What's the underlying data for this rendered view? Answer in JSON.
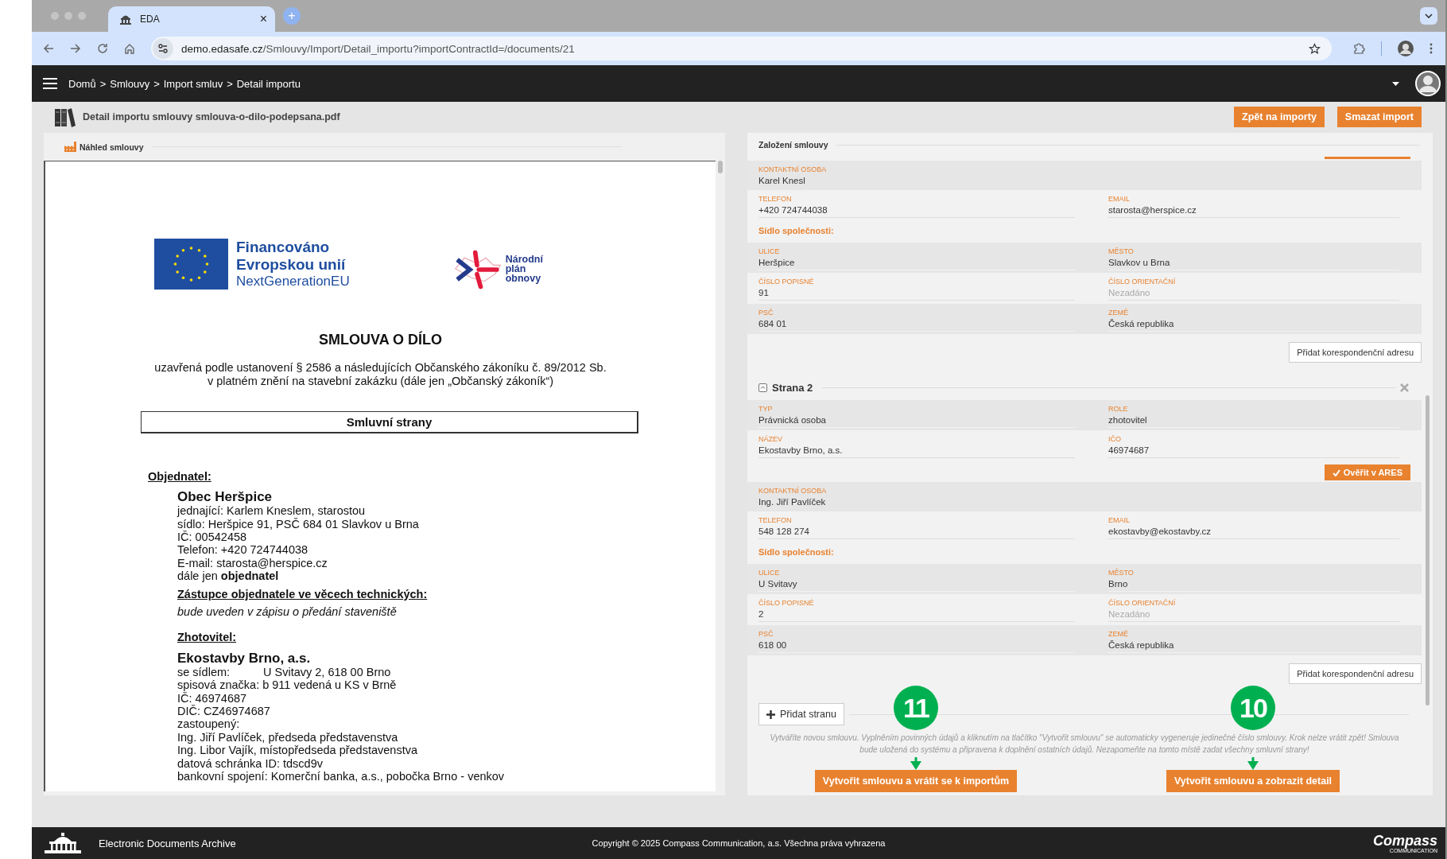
{
  "browser": {
    "tab": {
      "title": "EDA",
      "close": "×",
      "selected": true
    },
    "new_tab": "+",
    "url": {
      "host": "demo.edasafe.cz",
      "path": "/Smlouvy/Import/Detail_importu?importContractId=/documents/21"
    }
  },
  "app_bar": {
    "breadcrumb": [
      "Domů",
      "Smlouvy",
      "Import smluv",
      "Detail importu"
    ],
    "separator": ">"
  },
  "page_title": "Detail importu smlouvy smlouva-o-dilo-podepsana.pdf",
  "header_buttons": [
    "Zpět na importy",
    "Smazat import"
  ],
  "preview": {
    "title": "Náhled smlouvy",
    "document": {
      "eu_logo": [
        "Financováno",
        "Evropskou unií",
        "NextGenerationEU"
      ],
      "npo_logo": [
        "Národní",
        "plán",
        "obnovy"
      ],
      "title": "SMLOUVA O DÍLO",
      "subtitle": [
        "uzavřená podle ustanovení § 2586 a následujících Občanského zákoníku č. 89/2012 Sb.",
        "v platném znění na stavební zakázku (dále jen „Občanský zákoník“)"
      ],
      "section": "Smluvní strany",
      "blocks": [
        {
          "kind": "lead",
          "text": "Objednatel:"
        },
        {
          "kind": "name",
          "text": "Obec Heršpice"
        },
        {
          "kind": "line",
          "text": "jednající: Karlem Kneslem, starostou"
        },
        {
          "kind": "line",
          "text": "sídlo: Heršpice 91, PSČ 684 01 Slavkov u Brna"
        },
        {
          "kind": "line",
          "text": "IČ: 00542458"
        },
        {
          "kind": "line",
          "text": "Telefon: +420 724744038"
        },
        {
          "kind": "line",
          "text": "E-mail: starosta@herspice.cz"
        },
        {
          "kind": "line",
          "text": "dále jen **objednatel**"
        },
        {
          "kind": "heading",
          "text": "Zástupce objednatele ve věcech technických:"
        },
        {
          "kind": "note",
          "text": "bude uveden v zápisu o předání staveniště"
        },
        {
          "kind": "heading",
          "text": "Zhotovitel:"
        },
        {
          "kind": "name",
          "text": "Ekostavby Brno, a.s."
        },
        {
          "kind": "pair",
          "label": "se sídlem:",
          "value": "U Svitavy 2, 618 00 Brno"
        },
        {
          "kind": "line",
          "text": "spisová značka: b 911 vedená u KS v Brně"
        },
        {
          "kind": "line",
          "text": "IČ:  46974687"
        },
        {
          "kind": "line",
          "text": "DIČ:  CZ46974687"
        },
        {
          "kind": "line",
          "text": "zastoupený:"
        },
        {
          "kind": "line",
          "text": "Ing. Jiří Pavlíček, předseda představenstva"
        },
        {
          "kind": "line",
          "text": "Ing. Libor Vajík, místopředseda představenstva"
        },
        {
          "kind": "line",
          "text": "datová schránka ID: tdscd9v"
        },
        {
          "kind": "line",
          "text": "bankovní spojení: Komerční banka, a.s., pobočka Brno - venkov"
        }
      ]
    }
  },
  "form": {
    "title": "Založení smlouvy",
    "parties": [
      {
        "rows": [
          {
            "kind": "fields",
            "shaded": true,
            "fields": [
              {
                "label": "KONTAKTNÍ OSOBA",
                "value": "Karel Knesl"
              }
            ]
          },
          {
            "kind": "fields",
            "shaded": false,
            "fields": [
              {
                "label": "TELEFON",
                "value": "+420 724744038"
              },
              {
                "label": "EMAIL",
                "value": "starosta@herspice.cz"
              }
            ]
          },
          {
            "kind": "heading",
            "text": "Sídlo společnosti:"
          },
          {
            "kind": "fields",
            "shaded": true,
            "fields": [
              {
                "label": "ULICE",
                "value": "Heršpice"
              },
              {
                "label": "MĚSTO",
                "value": "Slavkov u Brna"
              }
            ]
          },
          {
            "kind": "fields",
            "shaded": false,
            "fields": [
              {
                "label": "ČÍSLO POPISNÉ",
                "value": "91"
              },
              {
                "label": "ČÍSLO ORIENTAČNÍ",
                "placeholder": "Nezadáno"
              }
            ]
          },
          {
            "kind": "fields",
            "shaded": true,
            "fields": [
              {
                "label": "PSČ",
                "value": "684 01"
              },
              {
                "label": "ZEMĚ",
                "value": "Česká republika"
              }
            ]
          }
        ],
        "add_address": "Přidat korespondenční adresu"
      },
      {
        "title": "Strana 2",
        "expanded": true,
        "rows": [
          {
            "kind": "fields",
            "shaded": true,
            "fields": [
              {
                "label": "TYP",
                "value": "Právnická osoba"
              },
              {
                "label": "ROLE",
                "value": "zhotovitel"
              }
            ]
          },
          {
            "kind": "fields",
            "shaded": false,
            "fields": [
              {
                "label": "NÁZEV",
                "value": "Ekostavby Brno, a.s."
              },
              {
                "label": "IČO",
                "value": "46974687"
              }
            ]
          },
          {
            "kind": "action",
            "label": "Ověřit v ARES"
          },
          {
            "kind": "fields",
            "shaded": true,
            "fields": [
              {
                "label": "KONTAKTNÍ OSOBA",
                "value": "Ing. Jiří Pavlíček"
              }
            ]
          },
          {
            "kind": "fields",
            "shaded": false,
            "fields": [
              {
                "label": "TELEFON",
                "value": "548 128 274"
              },
              {
                "label": "EMAIL",
                "value": "ekostavby@ekostavby.cz"
              }
            ]
          },
          {
            "kind": "heading",
            "text": "Sídlo společnosti:"
          },
          {
            "kind": "fields",
            "shaded": true,
            "fields": [
              {
                "label": "ULICE",
                "value": "U Svitavy"
              },
              {
                "label": "MĚSTO",
                "value": "Brno"
              }
            ]
          },
          {
            "kind": "fields",
            "shaded": false,
            "fields": [
              {
                "label": "ČÍSLO POPISNÉ",
                "value": "2"
              },
              {
                "label": "ČÍSLO ORIENTAČNÍ",
                "placeholder": "Nezadáno"
              }
            ]
          },
          {
            "kind": "fields",
            "shaded": true,
            "fields": [
              {
                "label": "PSČ",
                "value": "618 00"
              },
              {
                "label": "ZEMĚ",
                "value": "Česká republika"
              }
            ]
          }
        ],
        "add_address": "Přidat korespondenční adresu"
      }
    ],
    "add_party": "Přidat stranu",
    "note": "Vytváříte novou smlouvu. Vyplněním povinných údajů a kliknutím na tlačítko \"Vytvořit smlouvu\" se automaticky vygeneruje jedinečné číslo smlouvy. Krok nelze vrátit zpět! Smlouva bude uložená do systému a připravena k doplnění ostatních údajů. Nezapomeňte na tomto místě zadat všechny smluvní strany!",
    "actions": [
      {
        "label": "Vytvořit smlouvu a vrátit se k importům",
        "marker": "11"
      },
      {
        "label": "Vytvořit smlouvu a zobrazit detail",
        "marker": "10"
      }
    ]
  },
  "footer": {
    "app_name": "Electronic Documents Archive",
    "copyright": "Copyright © 2025 Compass Communication, a.s. Všechna práva vyhrazena",
    "brand": "Compass",
    "brand_tagline": "COMMUNICATION"
  }
}
